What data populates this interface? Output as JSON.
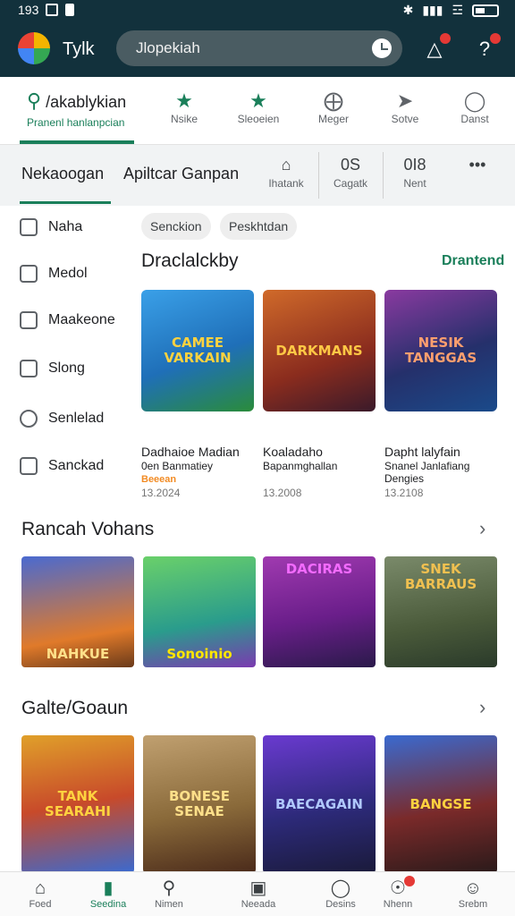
{
  "status": {
    "time": "193",
    "left_icons": [
      "photo-icon",
      "lock-icon"
    ],
    "right_icons": [
      "bluetooth-icon",
      "signal-icon",
      "wifi-icon",
      "battery-icon"
    ]
  },
  "appbar": {
    "title": "Tylk",
    "search_text": "Jlopekiah",
    "bg": "#12313c"
  },
  "categories": [
    {
      "line1": "/akablykian",
      "line2": "Pranenl hanlanpcian",
      "icon": "search-icon"
    },
    {
      "label": "Nsike",
      "icon": "star-icon"
    },
    {
      "label": "Sleoeien",
      "icon": "star-icon"
    },
    {
      "label": "Meger",
      "icon": "puzzle-icon"
    },
    {
      "label": "Sotve",
      "icon": "tag-icon"
    },
    {
      "label": "Danst",
      "icon": "globe-icon"
    }
  ],
  "tabs": {
    "tab1": "Nekaoogan",
    "tab2": "Apiltcar Ganpan",
    "minis": [
      {
        "top": "",
        "label": "Ihatank",
        "icon": "home-icon"
      },
      {
        "top": "0S",
        "label": "Cagatk",
        "icon": ""
      },
      {
        "top": "0I8",
        "label": "Nent",
        "icon": ""
      },
      {
        "top": "",
        "label": "",
        "icon": "more-icon"
      }
    ]
  },
  "sidebar": {
    "items": [
      {
        "label": "Naha",
        "icon": "home-icon"
      },
      {
        "label": "Medol",
        "icon": "calendar-icon"
      },
      {
        "label": "Maakeone",
        "icon": "check-icon"
      },
      {
        "label": "Slong",
        "icon": "chat-icon"
      },
      {
        "label": "Senlelad",
        "icon": "search-icon"
      },
      {
        "label": "Sanckad",
        "icon": "bag-icon"
      }
    ]
  },
  "chips": [
    "Senckion",
    "Peskhtdan"
  ],
  "featured": {
    "title": "Draclalckby",
    "link": "Drantend",
    "cards": [
      {
        "art": "CAMEE VARKAIN",
        "name": "Dadhaioe Madian",
        "sub": "0en Banmatiey",
        "badge": "Beeean",
        "date": "13.2024",
        "bg": "#1f6fb8",
        "fg": "#ffd23f"
      },
      {
        "art": "DARKMANS",
        "name": "Koaladaho",
        "sub": "Bapanmghallan",
        "badge": "",
        "date": "13.2008",
        "bg": "#8a2c1e",
        "fg": "#ffc845"
      },
      {
        "art": "NESIK TANGGAS",
        "name": "Dapht lalyfain",
        "sub": "Snanel Janlafiang Dengies",
        "badge": "",
        "date": "13.2108",
        "bg": "#25306b",
        "fg": "#ff9f6e"
      }
    ]
  },
  "section2": {
    "title": "Rancah Vohans",
    "cards": [
      {
        "art": "NAHKUE",
        "bg": "#e07a2a",
        "fg": "#ffe08a"
      },
      {
        "art": "Sonoinio",
        "bg": "#2a9c8c",
        "fg": "#ffe600"
      },
      {
        "art": "DACIRAS",
        "bg": "#6a1e8a",
        "fg": "#f36bff"
      },
      {
        "art": "SNEK BARRAUS",
        "bg": "#4a5a3a",
        "fg": "#f0c050"
      }
    ]
  },
  "section3": {
    "title": "Galte/Goaun",
    "cards": [
      {
        "art": "TANK SEARAHI",
        "bg": "#c84a2a",
        "fg": "#ffd23f"
      },
      {
        "art": "BONESE SENAE",
        "bg": "#8a6a3a",
        "fg": "#ffe08a"
      },
      {
        "art": "BAECAGAIN",
        "bg": "#2d2a7a",
        "fg": "#b0c8ff"
      },
      {
        "art": "BANGSE",
        "bg": "#7a2a2a",
        "fg": "#ffd23f"
      }
    ]
  },
  "bottom_nav": [
    {
      "label": "Foed",
      "icon": "home-icon"
    },
    {
      "label": "Seedina",
      "icon": "bookmark-icon"
    },
    {
      "label": "Nimen",
      "icon": "search-icon"
    },
    {
      "label": "Neeada",
      "icon": "calendar-icon"
    },
    {
      "label": "Desins",
      "icon": "chat-icon"
    },
    {
      "label": "Nhenn",
      "icon": "people-icon"
    },
    {
      "label": "Srebm",
      "icon": "person-icon"
    }
  ],
  "colors": {
    "accent": "#1a7f5a",
    "badge": "#e53935",
    "header": "#12313c"
  }
}
